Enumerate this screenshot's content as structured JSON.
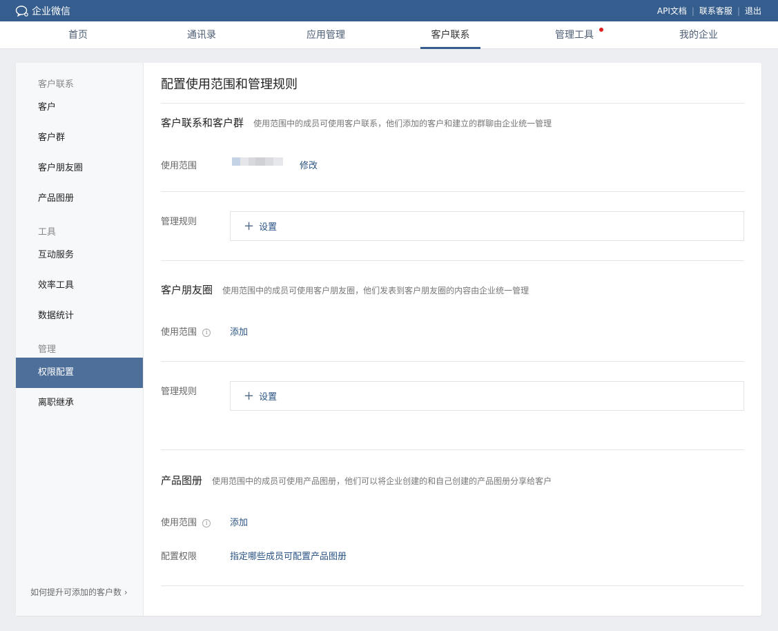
{
  "topbar": {
    "brand": "企业微信",
    "links": {
      "api_docs": "API文档",
      "support": "联系客服",
      "logout": "退出"
    },
    "separator": "|"
  },
  "nav": {
    "home": "首页",
    "contacts": "通讯录",
    "apps": "应用管理",
    "customer": "客户联系",
    "tools": "管理工具",
    "company": "我的企业"
  },
  "sidebar": {
    "group_customer": "客户联系",
    "item_customer": "客户",
    "item_group": "客户群",
    "item_moments": "客户朋友圈",
    "item_catalog": "产品图册",
    "group_tools": "工具",
    "item_interact": "互动服务",
    "item_efficiency": "效率工具",
    "item_stats": "数据统计",
    "group_manage": "管理",
    "item_permission": "权限配置",
    "item_transfer": "离职继承",
    "footer": "如何提升可添加的客户数"
  },
  "main": {
    "title": "配置使用范围和管理规则",
    "section1": {
      "title": "客户联系和客户群",
      "desc": "使用范围中的成员可使用客户联系，他们添加的客户和建立的群聊由企业统一管理",
      "scope_label": "使用范围",
      "modify": "修改",
      "rule_label": "管理规则",
      "set": "设置"
    },
    "section2": {
      "title": "客户朋友圈",
      "desc": "使用范围中的成员可使用客户朋友圈，他们发表到客户朋友圈的内容由企业统一管理",
      "scope_label": "使用范围",
      "add": "添加",
      "rule_label": "管理规则",
      "set": "设置"
    },
    "section3": {
      "title": "产品图册",
      "desc": "使用范围中的成员可使用产品图册，他们可以将企业创建的和自己创建的产品图册分享给客户",
      "scope_label": "使用范围",
      "add": "添加",
      "config_label": "配置权限",
      "config_link": "指定哪些成员可配置产品图册"
    },
    "info_glyph": "i",
    "plus_glyph": "+",
    "chevron_glyph": "›"
  },
  "colors": {
    "topbar": "#355d8d",
    "accent": "#4e6f9a",
    "link": "#2a5384",
    "notify_dot": "#e02020"
  }
}
